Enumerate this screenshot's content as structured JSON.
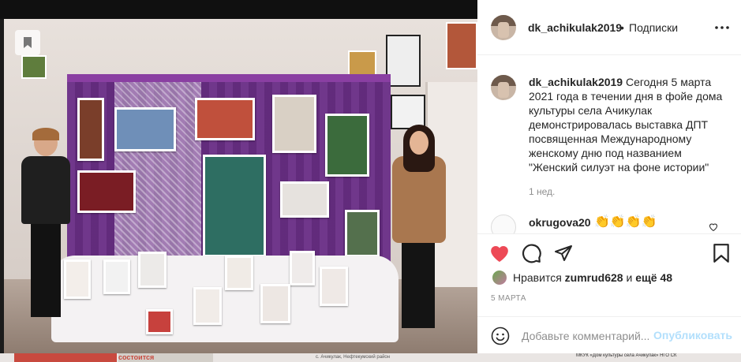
{
  "header": {
    "username": "dk_achikulak2019",
    "separator": "•",
    "follow_label": "Подписки",
    "more_icon": "more-horizontal-icon"
  },
  "caption": {
    "username": "dk_achikulak2019",
    "text": "Сегодня 5 марта 2021 года в течении дня в фойе дома культуры села Ачикулак демонстрировалась выставка ДПТ посвященная Международному женскому дню под названием \"Женский силуэт на фоне истории\"",
    "time": "1 нед."
  },
  "comment": {
    "username": "okrugova20",
    "text": "👏👏👏👏"
  },
  "actions": {
    "like_icon": "heart-filled-icon",
    "comment_icon": "comment-icon",
    "share_icon": "share-icon",
    "save_icon": "bookmark-icon",
    "like_color": "#ed4956"
  },
  "likes": {
    "prefix": "Нравится ",
    "user": "zumrud628",
    "middle": " и ",
    "others": "ещё 48"
  },
  "date": "5 МАРТА",
  "comment_box": {
    "placeholder": "Добавьте комментарий...",
    "publish_label": "Опубликовать",
    "publish_color": "#b2dffc"
  },
  "photo_footer": {
    "left_text": "состоится",
    "center_text": "с. Ачикулак, Нефтекумский район",
    "right_text": "МКУК «Дом культуры села Ачикулак» НГО СК"
  }
}
